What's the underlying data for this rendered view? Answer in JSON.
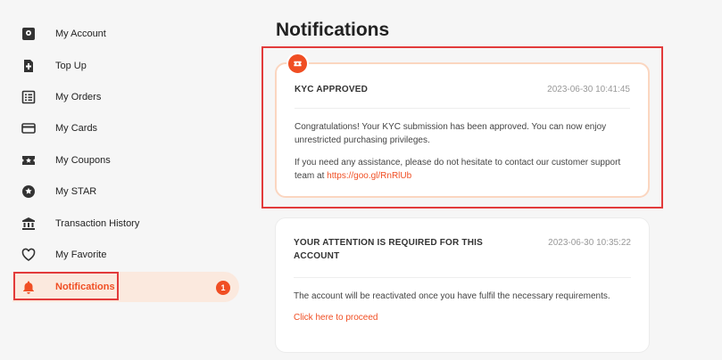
{
  "sidebar": {
    "items": [
      {
        "label": "My Account",
        "icon": "account-icon"
      },
      {
        "label": "Top Up",
        "icon": "top-up-icon"
      },
      {
        "label": "My Orders",
        "icon": "orders-icon"
      },
      {
        "label": "My Cards",
        "icon": "card-icon"
      },
      {
        "label": "My Coupons",
        "icon": "coupon-icon"
      },
      {
        "label": "My STAR",
        "icon": "star-icon"
      },
      {
        "label": "Transaction History",
        "icon": "bank-icon"
      },
      {
        "label": "My Favorite",
        "icon": "heart-icon"
      },
      {
        "label": "Notifications",
        "icon": "bell-icon",
        "active": true,
        "badge": "1"
      }
    ]
  },
  "main": {
    "title": "Notifications",
    "notifications": [
      {
        "title": "KYC APPROVED",
        "date": "2023-06-30 10:41:45",
        "body1": "Congratulations! Your KYC submission has been approved. You can now enjoy unrestricted purchasing privileges.",
        "body2_prefix": "If you need any assistance, please do not hesitate to contact our customer support team at ",
        "link": "https://goo.gl/RnRlUb",
        "unread": true
      },
      {
        "title": "YOUR ATTENTION IS REQUIRED FOR THIS ACCOUNT",
        "date": "2023-06-30 10:35:22",
        "body1": "The account will be reactivated once you have fulfil the necessary requirements.",
        "link": "Click here to proceed",
        "unread": false
      }
    ]
  },
  "colors": {
    "accent": "#f04e23",
    "active_bg": "#fbe9de",
    "highlight": "#e23b3b"
  }
}
